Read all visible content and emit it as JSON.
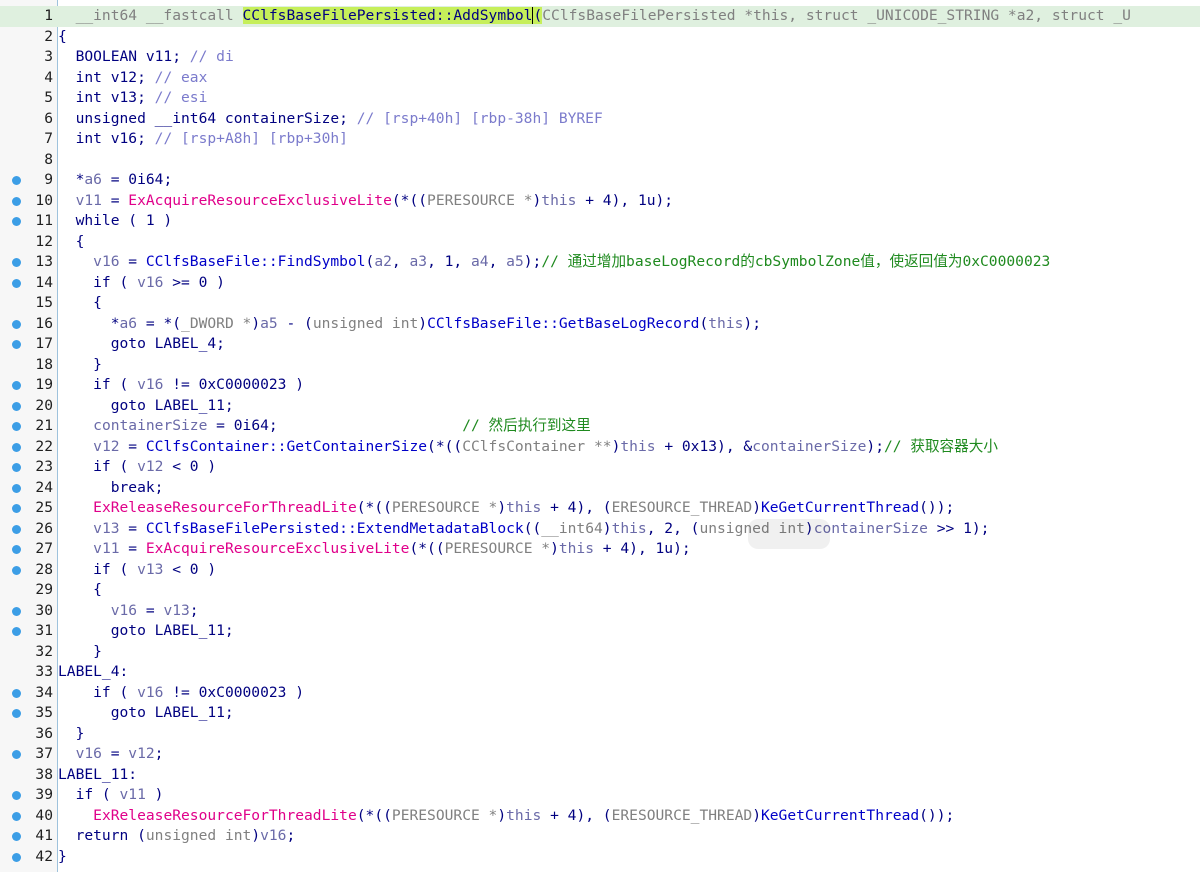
{
  "editor": {
    "lines": [
      {
        "n": "1",
        "bp": false,
        "hl": true,
        "segs": [
          {
            "t": "  __int64 __fastcall ",
            "c": "gr"
          },
          {
            "t": "CClfsBaseFilePersisted::AddSymbol",
            "c": "hlb"
          },
          {
            "t": "(",
            "c": "hlb cur"
          },
          {
            "t": "CClfsBaseFilePersisted *this, struct _UNICODE_STRING *a2, struct _U",
            "c": "gr"
          }
        ]
      },
      {
        "n": "2",
        "bp": false,
        "segs": [
          {
            "t": "{",
            "c": "kw"
          }
        ]
      },
      {
        "n": "3",
        "bp": false,
        "segs": [
          {
            "t": "  BOOLEAN v11; ",
            "c": "ty"
          },
          {
            "t": "// di",
            "c": "cmv"
          }
        ]
      },
      {
        "n": "4",
        "bp": false,
        "segs": [
          {
            "t": "  int v12; ",
            "c": "ty"
          },
          {
            "t": "// eax",
            "c": "cmv"
          }
        ]
      },
      {
        "n": "5",
        "bp": false,
        "segs": [
          {
            "t": "  int v13; ",
            "c": "ty"
          },
          {
            "t": "// esi",
            "c": "cmv"
          }
        ]
      },
      {
        "n": "6",
        "bp": false,
        "segs": [
          {
            "t": "  unsigned __int64 containerSize; ",
            "c": "ty"
          },
          {
            "t": "// [rsp+40h] [rbp-38h] BYREF",
            "c": "cmv"
          }
        ]
      },
      {
        "n": "7",
        "bp": false,
        "segs": [
          {
            "t": "  int v16; ",
            "c": "ty"
          },
          {
            "t": "// [rsp+A8h] [rbp+30h]",
            "c": "cmv"
          }
        ]
      },
      {
        "n": "8",
        "bp": false,
        "segs": []
      },
      {
        "n": "9",
        "bp": true,
        "segs": [
          {
            "t": "  *",
            "c": "kw"
          },
          {
            "t": "a6",
            "c": "var"
          },
          {
            "t": " = 0i64;",
            "c": "num"
          }
        ]
      },
      {
        "n": "10",
        "bp": true,
        "segs": [
          {
            "t": "  ",
            "c": "kw"
          },
          {
            "t": "v11",
            "c": "var"
          },
          {
            "t": " = ",
            "c": "kw"
          },
          {
            "t": "ExAcquireResourceExclusiveLite",
            "c": "fnp"
          },
          {
            "t": "(*((",
            "c": "kw"
          },
          {
            "t": "PERESOURCE *",
            "c": "gr"
          },
          {
            "t": ")",
            "c": "kw"
          },
          {
            "t": "this",
            "c": "var"
          },
          {
            "t": " + 4), 1u);",
            "c": "kw"
          }
        ]
      },
      {
        "n": "11",
        "bp": true,
        "segs": [
          {
            "t": "  while ( 1 )",
            "c": "kw"
          }
        ]
      },
      {
        "n": "12",
        "bp": false,
        "segs": [
          {
            "t": "  {",
            "c": "kw"
          }
        ]
      },
      {
        "n": "13",
        "bp": true,
        "segs": [
          {
            "t": "    ",
            "c": "kw"
          },
          {
            "t": "v16",
            "c": "var"
          },
          {
            "t": " = ",
            "c": "kw"
          },
          {
            "t": "CClfsBaseFile::FindSymbol",
            "c": "fn"
          },
          {
            "t": "(",
            "c": "kw"
          },
          {
            "t": "a2",
            "c": "var"
          },
          {
            "t": ", ",
            "c": "kw"
          },
          {
            "t": "a3",
            "c": "var"
          },
          {
            "t": ", 1, ",
            "c": "kw"
          },
          {
            "t": "a4",
            "c": "var"
          },
          {
            "t": ", ",
            "c": "kw"
          },
          {
            "t": "a5",
            "c": "var"
          },
          {
            "t": ");",
            "c": "kw"
          },
          {
            "t": "// 通过增加baseLogRecord的cbSymbolZone值，使返回值为0xC0000023",
            "c": "cm"
          }
        ]
      },
      {
        "n": "14",
        "bp": true,
        "segs": [
          {
            "t": "    if ( ",
            "c": "kw"
          },
          {
            "t": "v16",
            "c": "var"
          },
          {
            "t": " >= 0 )",
            "c": "kw"
          }
        ]
      },
      {
        "n": "15",
        "bp": false,
        "segs": [
          {
            "t": "    {",
            "c": "kw"
          }
        ]
      },
      {
        "n": "16",
        "bp": true,
        "segs": [
          {
            "t": "      *",
            "c": "kw"
          },
          {
            "t": "a6",
            "c": "var"
          },
          {
            "t": " = *(",
            "c": "kw"
          },
          {
            "t": "_DWORD *",
            "c": "gr"
          },
          {
            "t": ")",
            "c": "kw"
          },
          {
            "t": "a5",
            "c": "var"
          },
          {
            "t": " - (",
            "c": "kw"
          },
          {
            "t": "unsigned int",
            "c": "gr"
          },
          {
            "t": ")",
            "c": "kw"
          },
          {
            "t": "CClfsBaseFile::GetBaseLogRecord",
            "c": "fn"
          },
          {
            "t": "(",
            "c": "kw"
          },
          {
            "t": "this",
            "c": "var"
          },
          {
            "t": ");",
            "c": "kw"
          }
        ]
      },
      {
        "n": "17",
        "bp": true,
        "segs": [
          {
            "t": "      goto LABEL_4;",
            "c": "kw"
          }
        ]
      },
      {
        "n": "18",
        "bp": false,
        "segs": [
          {
            "t": "    }",
            "c": "kw"
          }
        ]
      },
      {
        "n": "19",
        "bp": true,
        "segs": [
          {
            "t": "    if ( ",
            "c": "kw"
          },
          {
            "t": "v16",
            "c": "var"
          },
          {
            "t": " != 0xC0000023 )",
            "c": "kw"
          }
        ]
      },
      {
        "n": "20",
        "bp": true,
        "segs": [
          {
            "t": "      goto LABEL_11;",
            "c": "kw"
          }
        ]
      },
      {
        "n": "21",
        "bp": true,
        "segs": [
          {
            "t": "    ",
            "c": "kw"
          },
          {
            "t": "containerSize",
            "c": "var"
          },
          {
            "t": " = 0i64;                     ",
            "c": "kw"
          },
          {
            "t": "// 然后执行到这里",
            "c": "cm"
          }
        ]
      },
      {
        "n": "22",
        "bp": true,
        "segs": [
          {
            "t": "    ",
            "c": "kw"
          },
          {
            "t": "v12",
            "c": "var"
          },
          {
            "t": " = ",
            "c": "kw"
          },
          {
            "t": "CClfsContainer::GetContainerSize",
            "c": "fn"
          },
          {
            "t": "(*((",
            "c": "kw"
          },
          {
            "t": "CClfsContainer **",
            "c": "gr"
          },
          {
            "t": ")",
            "c": "kw"
          },
          {
            "t": "this",
            "c": "var"
          },
          {
            "t": " + 0x13), &",
            "c": "kw"
          },
          {
            "t": "containerSize",
            "c": "var"
          },
          {
            "t": ");",
            "c": "kw"
          },
          {
            "t": "// 获取容器大小",
            "c": "cm"
          }
        ]
      },
      {
        "n": "23",
        "bp": true,
        "segs": [
          {
            "t": "    if ( ",
            "c": "kw"
          },
          {
            "t": "v12",
            "c": "var"
          },
          {
            "t": " < 0 )",
            "c": "kw"
          }
        ]
      },
      {
        "n": "24",
        "bp": true,
        "segs": [
          {
            "t": "      break;",
            "c": "kw"
          }
        ]
      },
      {
        "n": "25",
        "bp": true,
        "segs": [
          {
            "t": "    ",
            "c": "kw"
          },
          {
            "t": "ExReleaseResourceForThreadLite",
            "c": "fnp"
          },
          {
            "t": "(*((",
            "c": "kw"
          },
          {
            "t": "PERESOURCE *",
            "c": "gr"
          },
          {
            "t": ")",
            "c": "kw"
          },
          {
            "t": "this",
            "c": "var"
          },
          {
            "t": " + 4), (",
            "c": "kw"
          },
          {
            "t": "ERESOURCE_THREAD",
            "c": "gr"
          },
          {
            "t": ")",
            "c": "kw"
          },
          {
            "t": "KeGetCurrentThread",
            "c": "fn"
          },
          {
            "t": "());",
            "c": "kw"
          }
        ]
      },
      {
        "n": "26",
        "bp": true,
        "segs": [
          {
            "t": "    ",
            "c": "kw"
          },
          {
            "t": "v13",
            "c": "var"
          },
          {
            "t": " = ",
            "c": "kw"
          },
          {
            "t": "CClfsBaseFilePersisted::ExtendMetadataBlock",
            "c": "fn"
          },
          {
            "t": "((",
            "c": "kw"
          },
          {
            "t": "__int64",
            "c": "gr"
          },
          {
            "t": ")",
            "c": "kw"
          },
          {
            "t": "this",
            "c": "var"
          },
          {
            "t": ", 2, (",
            "c": "kw"
          },
          {
            "t": "unsigned int",
            "c": "gr"
          },
          {
            "t": ")",
            "c": "kw"
          },
          {
            "t": "containerSize",
            "c": "var"
          },
          {
            "t": " >> 1);",
            "c": "kw"
          }
        ]
      },
      {
        "n": "27",
        "bp": true,
        "segs": [
          {
            "t": "    ",
            "c": "kw"
          },
          {
            "t": "v11",
            "c": "var"
          },
          {
            "t": " = ",
            "c": "kw"
          },
          {
            "t": "ExAcquireResourceExclusiveLite",
            "c": "fnp"
          },
          {
            "t": "(*((",
            "c": "kw"
          },
          {
            "t": "PERESOURCE *",
            "c": "gr"
          },
          {
            "t": ")",
            "c": "kw"
          },
          {
            "t": "this",
            "c": "var"
          },
          {
            "t": " + 4), 1u);",
            "c": "kw"
          }
        ]
      },
      {
        "n": "28",
        "bp": true,
        "segs": [
          {
            "t": "    if ( ",
            "c": "kw"
          },
          {
            "t": "v13",
            "c": "var"
          },
          {
            "t": " < 0 )",
            "c": "kw"
          }
        ]
      },
      {
        "n": "29",
        "bp": false,
        "segs": [
          {
            "t": "    {",
            "c": "kw"
          }
        ]
      },
      {
        "n": "30",
        "bp": true,
        "segs": [
          {
            "t": "      ",
            "c": "kw"
          },
          {
            "t": "v16",
            "c": "var"
          },
          {
            "t": " = ",
            "c": "kw"
          },
          {
            "t": "v13",
            "c": "var"
          },
          {
            "t": ";",
            "c": "kw"
          }
        ]
      },
      {
        "n": "31",
        "bp": true,
        "segs": [
          {
            "t": "      goto LABEL_11;",
            "c": "kw"
          }
        ]
      },
      {
        "n": "32",
        "bp": false,
        "segs": [
          {
            "t": "    }",
            "c": "kw"
          }
        ]
      },
      {
        "n": "33",
        "bp": false,
        "segs": [
          {
            "t": "LABEL_4:",
            "c": "kw"
          }
        ]
      },
      {
        "n": "34",
        "bp": true,
        "segs": [
          {
            "t": "    if ( ",
            "c": "kw"
          },
          {
            "t": "v16",
            "c": "var"
          },
          {
            "t": " != 0xC0000023 )",
            "c": "kw"
          }
        ]
      },
      {
        "n": "35",
        "bp": true,
        "segs": [
          {
            "t": "      goto LABEL_11;",
            "c": "kw"
          }
        ]
      },
      {
        "n": "36",
        "bp": false,
        "segs": [
          {
            "t": "  }",
            "c": "kw"
          }
        ]
      },
      {
        "n": "37",
        "bp": true,
        "segs": [
          {
            "t": "  ",
            "c": "kw"
          },
          {
            "t": "v16",
            "c": "var"
          },
          {
            "t": " = ",
            "c": "kw"
          },
          {
            "t": "v12",
            "c": "var"
          },
          {
            "t": ";",
            "c": "kw"
          }
        ]
      },
      {
        "n": "38",
        "bp": false,
        "segs": [
          {
            "t": "LABEL_11:",
            "c": "kw"
          }
        ]
      },
      {
        "n": "39",
        "bp": true,
        "segs": [
          {
            "t": "  if ( ",
            "c": "kw"
          },
          {
            "t": "v11",
            "c": "var"
          },
          {
            "t": " )",
            "c": "kw"
          }
        ]
      },
      {
        "n": "40",
        "bp": true,
        "segs": [
          {
            "t": "    ",
            "c": "kw"
          },
          {
            "t": "ExReleaseResourceForThreadLite",
            "c": "fnp"
          },
          {
            "t": "(*((",
            "c": "kw"
          },
          {
            "t": "PERESOURCE *",
            "c": "gr"
          },
          {
            "t": ")",
            "c": "kw"
          },
          {
            "t": "this",
            "c": "var"
          },
          {
            "t": " + 4), (",
            "c": "kw"
          },
          {
            "t": "ERESOURCE_THREAD",
            "c": "gr"
          },
          {
            "t": ")",
            "c": "kw"
          },
          {
            "t": "KeGetCurrentThread",
            "c": "fn"
          },
          {
            "t": "());",
            "c": "kw"
          }
        ]
      },
      {
        "n": "41",
        "bp": true,
        "segs": [
          {
            "t": "  return (",
            "c": "kw"
          },
          {
            "t": "unsigned int",
            "c": "gr"
          },
          {
            "t": ")",
            "c": "kw"
          },
          {
            "t": "v16",
            "c": "var"
          },
          {
            "t": ";",
            "c": "kw"
          }
        ]
      },
      {
        "n": "42",
        "bp": true,
        "segs": [
          {
            "t": "}",
            "c": "kw"
          }
        ]
      }
    ]
  }
}
